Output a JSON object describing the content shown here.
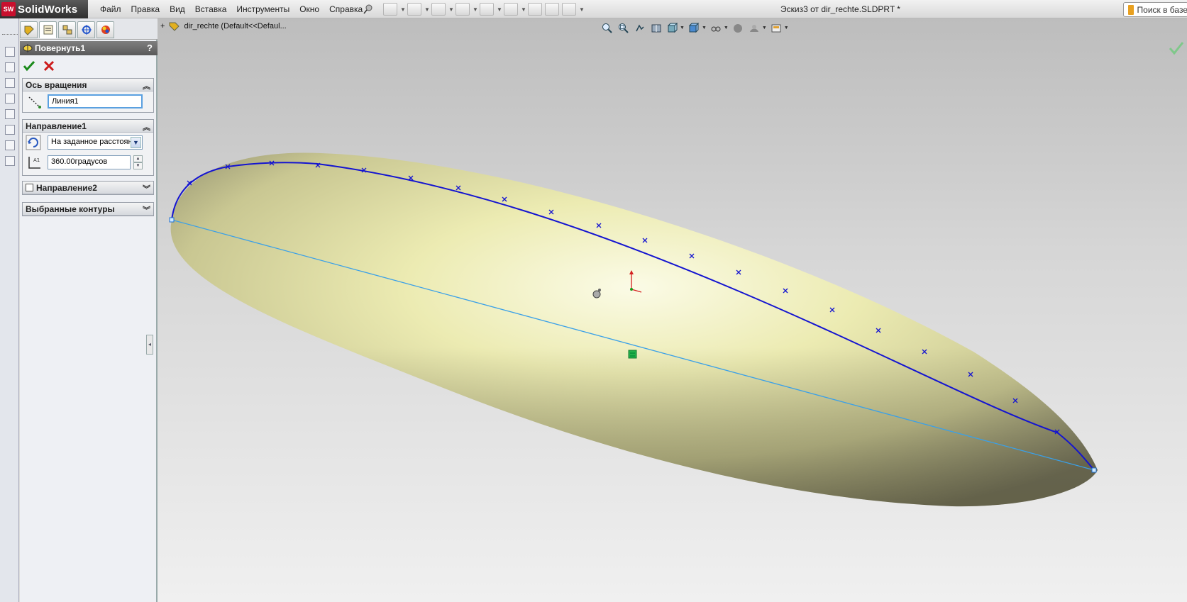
{
  "app": {
    "brand": "SolidWorks",
    "brand_mark": "SW",
    "menu": [
      "Файл",
      "Правка",
      "Вид",
      "Вставка",
      "Инструменты",
      "Окно",
      "Справка"
    ],
    "document_title": "Эскиз3 от dir_rechte.SLDPRT *",
    "search_placeholder": "Поиск в базе"
  },
  "property_manager": {
    "tabs": [
      "feature-manager-icon",
      "property-manager-icon",
      "configuration-manager-icon",
      "dimxpert-icon",
      "display-manager-icon"
    ],
    "feature_title": "Повернуть1",
    "help": "?",
    "axis_group": {
      "title": "Ось вращения",
      "axis_value": "Линия1"
    },
    "direction1_group": {
      "title": "Направление1",
      "end_condition": "На заданное расстояни",
      "angle": "360.00градусов"
    },
    "direction2_group": {
      "title": "Направление2",
      "checked": false
    },
    "contours_group": {
      "title": "Выбранные контуры"
    }
  },
  "graphics": {
    "tree_root": "dir_rechte  (Default<<Defaul...",
    "colors": {
      "body": "#e8e6a8",
      "profile": "#1414d0",
      "axis_line": "#3aa0e8",
      "endpoint": "#1e6fd0"
    }
  }
}
